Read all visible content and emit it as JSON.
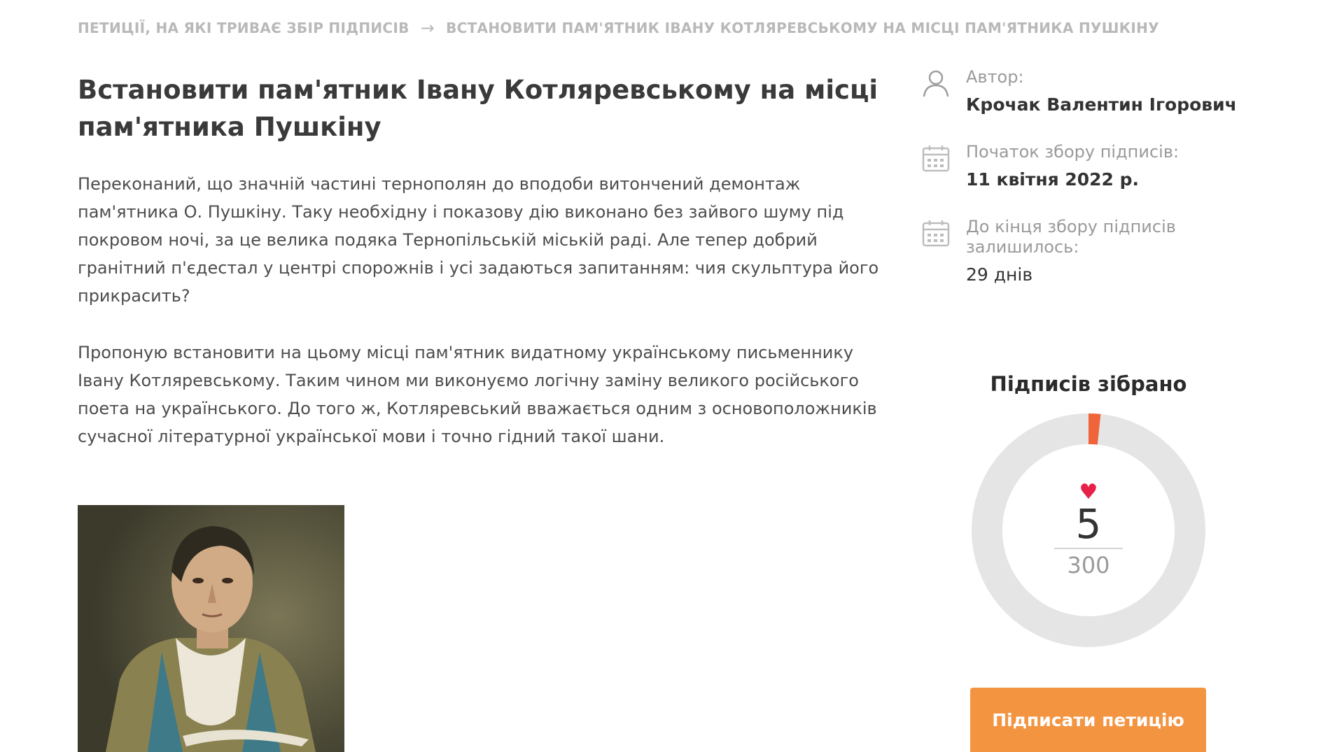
{
  "breadcrumb": {
    "parent": "ПЕТИЦІЇ, НА ЯКІ ТРИВАЄ ЗБІР ПІДПИСІВ",
    "separator": "→",
    "current": "ВСТАНОВИТИ ПАМ'ЯТНИК ІВАНУ КОТЛЯРЕВСЬКОМУ НА МІСЦІ ПАМ'ЯТНИКА ПУШКІНУ"
  },
  "petition": {
    "title": "Встановити пам'ятник Івану Котляревському на місці пам'ятника Пушкіну",
    "paragraphs": [
      "Переконаний, що значній частині тернополян до вподоби витончений демонтаж пам'ятника О. Пушкіну. Таку необхідну і показову дію виконано без зайвого шуму під покровом ночі, за це велика подяка Тернопільській міській раді. Але тепер добрий гранітний п'єдестал у центрі спорожнів і усі задаються запитанням: чия скульптура його прикрасить?",
      "Пропоную встановити на цьому місці пам'ятник видатному українському письменнику Івану Котляревському. Таким чином ми виконуємо логічну заміну великого російського поета на українського. До того ж, Котляревський вважається одним з основоположників сучасної літературної української мови і точно гідний такої шани."
    ]
  },
  "sidebar": {
    "author_label": "Автор:",
    "author_name": "Крочак Валентин Ігорович",
    "start_label": "Початок збору підписів:",
    "start_date": "11 квітня 2022 р.",
    "remaining_label": "До кінця збору підписів залишилось:",
    "remaining_value": "29 днів"
  },
  "signatures": {
    "title": "Підписів зібрано",
    "collected": "5",
    "goal": "300",
    "heart": "♥",
    "progress_fraction": 0.0167
  },
  "button": {
    "sign_label": "Підписати петицію"
  },
  "colors": {
    "accent": "#f39441",
    "progress": "#f0643c",
    "track": "#e5e5e5",
    "heart": "#e8214a",
    "muted": "#b9b9b9"
  },
  "icons": {
    "author": "user-icon",
    "start": "calendar-icon",
    "remaining": "calendar-icon"
  }
}
